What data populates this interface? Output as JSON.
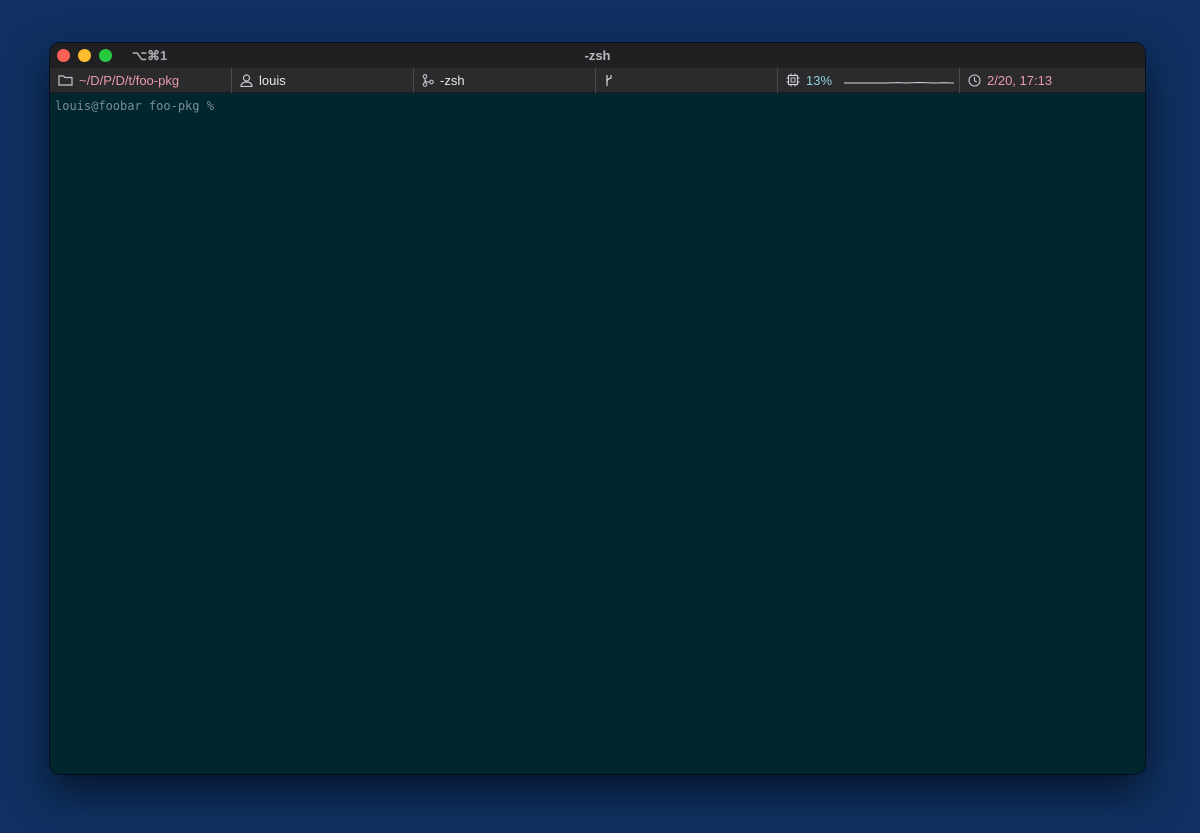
{
  "window": {
    "title": "-zsh",
    "shortcut": "⌥⌘1"
  },
  "statusbar": {
    "path": "~/D/P/D/t/foo-pkg",
    "user": "louis",
    "job": "-zsh",
    "branch": "",
    "cpu": "13%",
    "clock": "2/20, 17:13"
  },
  "terminal": {
    "prompt": "louis@foobar foo-pkg %"
  },
  "colors": {
    "desktop": "#0f3060",
    "terminal_bg": "#00262e",
    "path_text": "#e89aa6",
    "cpu_text": "#8cd0d8"
  }
}
